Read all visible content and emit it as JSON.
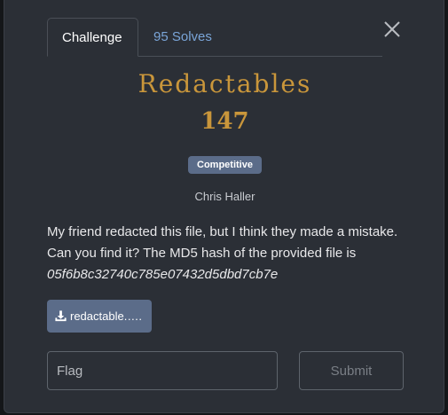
{
  "tabs": {
    "challenge_label": "Challenge",
    "solves_label": "95 Solves"
  },
  "challenge": {
    "name": "Redactables",
    "points": "147",
    "category_badge": "Competitive",
    "author": "Chris Haller",
    "description_text": "My friend redacted this file, but I think they made a mistake. Can you find it? The MD5 hash of the provided file is ",
    "description_hash": "05f6b8c32740c785e07432d5dbd7cb7e"
  },
  "file": {
    "label": "redactable.…."
  },
  "form": {
    "flag_placeholder": "Flag",
    "flag_value": "",
    "submit_label": "Submit"
  },
  "icons": {
    "close": "close-icon",
    "download": "download-icon"
  },
  "colors": {
    "modal_bg": "#2b2f36",
    "title_gold": "#c9963b",
    "link_blue": "#7aa5d8",
    "badge_bg": "#5b6c89"
  }
}
